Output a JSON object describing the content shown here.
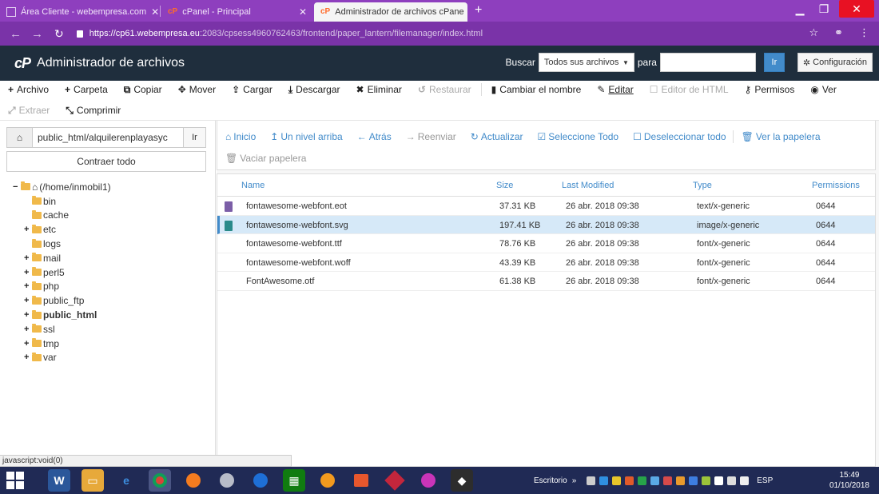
{
  "browser": {
    "tabs": [
      {
        "label": "Área Cliente - webempresa.com",
        "active": false
      },
      {
        "label": "cPanel - Principal",
        "active": false
      },
      {
        "label": "Administrador de archivos cPane",
        "active": true
      }
    ],
    "url_host": "https://cp61.webempresa.eu",
    "url_path": ":2083/cpsess4960762463/frontend/paper_lantern/filemanager/index.html"
  },
  "header": {
    "logo": "cP",
    "title": "Administrador de archivos",
    "search_label": "Buscar",
    "search_scope": "Todos sus archivos",
    "for_label": "para",
    "search_value": "",
    "go_label": "Ir",
    "config_label": "Configuración"
  },
  "toolbar": {
    "row1": [
      {
        "name": "toolbar-file-button",
        "icon": "+",
        "label": "Archivo",
        "disabled": false
      },
      {
        "name": "toolbar-folder-button",
        "icon": "+",
        "label": "Carpeta",
        "disabled": false
      },
      {
        "name": "toolbar-copy-button",
        "icon": "⧉",
        "label": "Copiar",
        "disabled": false
      },
      {
        "name": "toolbar-move-button",
        "icon": "✥",
        "label": "Mover",
        "disabled": false
      },
      {
        "name": "toolbar-upload-button",
        "icon": "⇪",
        "label": "Cargar",
        "disabled": false
      },
      {
        "name": "toolbar-download-button",
        "icon": "⤓",
        "label": "Descargar",
        "disabled": false
      },
      {
        "name": "toolbar-delete-button",
        "icon": "✖",
        "label": "Eliminar",
        "disabled": false
      },
      {
        "name": "toolbar-restore-button",
        "icon": "↺",
        "label": "Restaurar",
        "disabled": true
      },
      {
        "name": "toolbar-rename-button",
        "icon": "▮",
        "label": "Cambiar el nombre",
        "disabled": false
      },
      {
        "name": "toolbar-edit-button",
        "icon": "✎",
        "label": "Editar",
        "disabled": false
      },
      {
        "name": "toolbar-html-editor-button",
        "icon": "☐",
        "label": "Editor de HTML",
        "disabled": true
      },
      {
        "name": "toolbar-permissions-button",
        "icon": "⚷",
        "label": "Permisos",
        "disabled": false
      },
      {
        "name": "toolbar-view-button",
        "icon": "◉",
        "label": "Ver",
        "disabled": false
      }
    ],
    "row2": [
      {
        "name": "toolbar-extract-button",
        "icon": "⤢",
        "label": "Extraer",
        "disabled": true
      },
      {
        "name": "toolbar-compress-button",
        "icon": "⤡",
        "label": "Comprimir",
        "disabled": false
      }
    ]
  },
  "left": {
    "path_value": "public_html/alquilerenplayasyc",
    "go_label": "Ir",
    "collapse_label": "Contraer todo",
    "tree_root": "(/home/inmobil1)",
    "tree": [
      {
        "label": "bin",
        "expandable": false,
        "bold": false
      },
      {
        "label": "cache",
        "expandable": false,
        "bold": false
      },
      {
        "label": "etc",
        "expandable": true,
        "bold": false
      },
      {
        "label": "logs",
        "expandable": false,
        "bold": false
      },
      {
        "label": "mail",
        "expandable": true,
        "bold": false
      },
      {
        "label": "perl5",
        "expandable": true,
        "bold": false
      },
      {
        "label": "php",
        "expandable": true,
        "bold": false
      },
      {
        "label": "public_ftp",
        "expandable": true,
        "bold": false
      },
      {
        "label": "public_html",
        "expandable": true,
        "bold": true
      },
      {
        "label": "ssl",
        "expandable": true,
        "bold": false
      },
      {
        "label": "tmp",
        "expandable": true,
        "bold": false
      },
      {
        "label": "var",
        "expandable": true,
        "bold": false
      }
    ]
  },
  "actions": {
    "row1": [
      {
        "name": "action-home",
        "icon": "⌂",
        "label": "Inicio",
        "disabled": false
      },
      {
        "name": "action-up-one-level",
        "icon": "↥",
        "label": "Un nivel arriba",
        "disabled": false
      },
      {
        "name": "action-back",
        "icon": "←",
        "label": "Atrás",
        "disabled": false
      },
      {
        "name": "action-forward",
        "icon": "→",
        "label": "Reenviar",
        "disabled": true
      },
      {
        "name": "action-refresh",
        "icon": "↻",
        "label": "Actualizar",
        "disabled": false
      },
      {
        "name": "action-select-all",
        "icon": "☑",
        "label": "Seleccione Todo",
        "disabled": false
      },
      {
        "name": "action-unselect-all",
        "icon": "☐",
        "label": "Deseleccionar todo",
        "disabled": false
      },
      {
        "name": "action-view-trash",
        "icon": "🗑",
        "label": "Ver la papelera",
        "disabled": false
      }
    ],
    "row2": [
      {
        "name": "action-empty-trash",
        "icon": "🗑",
        "label": "Vaciar papelera",
        "disabled": true
      }
    ]
  },
  "table": {
    "columns": [
      "Name",
      "Size",
      "Last Modified",
      "Type",
      "Permissions"
    ],
    "rows": [
      {
        "icon": "generic-file-icon",
        "name": "fontawesome-webfont.eot",
        "size": "37.31 KB",
        "modified": "26 abr. 2018 09:38",
        "type": "text/x-generic",
        "perms": "0644",
        "selected": false
      },
      {
        "icon": "image-file-icon",
        "name": "fontawesome-webfont.svg",
        "size": "197.41 KB",
        "modified": "26 abr. 2018 09:38",
        "type": "image/x-generic",
        "perms": "0644",
        "selected": true
      },
      {
        "icon": "",
        "name": "fontawesome-webfont.ttf",
        "size": "78.76 KB",
        "modified": "26 abr. 2018 09:38",
        "type": "font/x-generic",
        "perms": "0644",
        "selected": false
      },
      {
        "icon": "",
        "name": "fontawesome-webfont.woff",
        "size": "43.39 KB",
        "modified": "26 abr. 2018 09:38",
        "type": "font/x-generic",
        "perms": "0644",
        "selected": false
      },
      {
        "icon": "",
        "name": "FontAwesome.otf",
        "size": "61.38 KB",
        "modified": "26 abr. 2018 09:38",
        "type": "font/x-generic",
        "perms": "0644",
        "selected": false
      }
    ]
  },
  "status_text": "javascript:void(0)",
  "taskbar": {
    "desktop_label": "Escritorio",
    "chevron": "»",
    "lang": "ESP",
    "time": "15:49",
    "date": "01/10/2018"
  },
  "colors": {
    "browser_frame": "#8e3fbe",
    "cpanel_header": "#1f2e3d",
    "link_blue": "#428bca",
    "selected_row": "#d6e9f8",
    "taskbar": "#202a55"
  }
}
